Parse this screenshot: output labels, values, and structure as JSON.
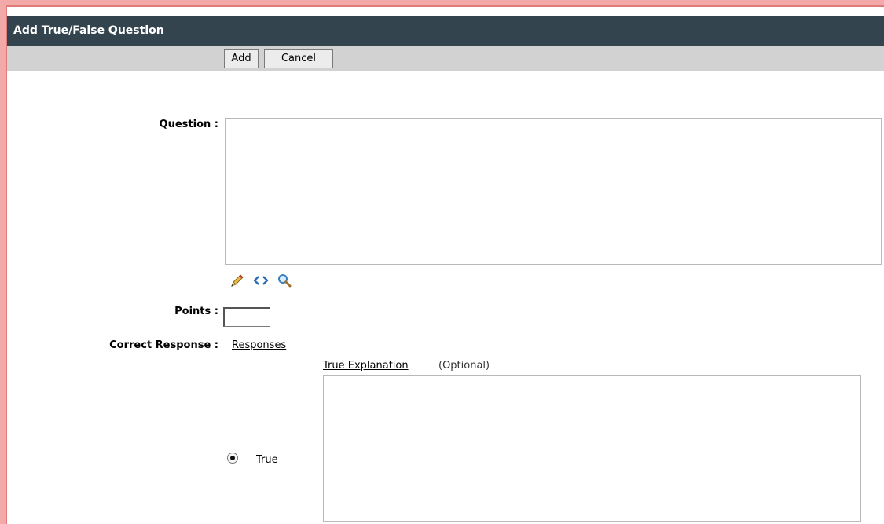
{
  "dialog": {
    "title": "Add True/False Question"
  },
  "toolbar": {
    "add_label": "Add",
    "cancel_label": "Cancel"
  },
  "form": {
    "question_label": "Question :",
    "question_value": "",
    "editor_icons": [
      "pencil-icon",
      "code-icon",
      "magnifier-icon"
    ],
    "points_label": "Points :",
    "points_value": "",
    "correct_response_label": "Correct Response :",
    "responses_link": "Responses",
    "true_option": {
      "label": "True",
      "selected": true,
      "explanation_link": "True Explanation",
      "explanation_optional": "(Optional)",
      "explanation_value": ""
    }
  },
  "colors": {
    "titlebar": "#33444f",
    "toolbar": "#d2d2d2",
    "window_border": "#e07b7b"
  }
}
